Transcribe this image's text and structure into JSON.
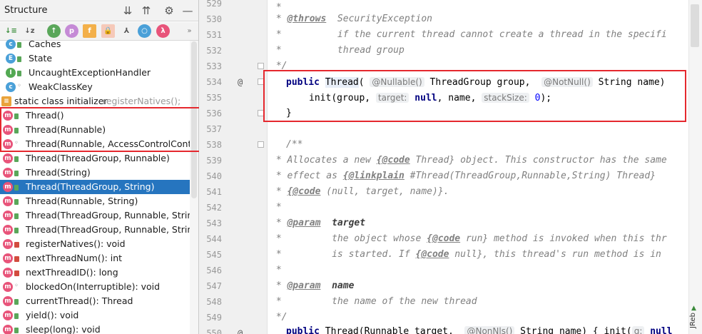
{
  "structure_panel": {
    "title": "Structure",
    "header_buttons": [
      "expand-all-icon",
      "collapse-all-icon",
      "gear-icon",
      "minimize-icon"
    ],
    "toolbar": [
      "sort-by-visibility",
      "sort-alpha",
      "show-inherited",
      "show-properties",
      "show-fields",
      "show-non-public",
      "show-anonymous",
      "show-lambdas",
      "more"
    ],
    "rows": [
      {
        "kind": "c",
        "vis": "pub",
        "label": "Caches",
        "indent": 4
      },
      {
        "kind": "e",
        "vis": "pub",
        "label": "State",
        "indent": 4
      },
      {
        "kind": "i",
        "vis": "pub",
        "label": "UncaughtExceptionHandler",
        "indent": 4
      },
      {
        "kind": "c",
        "vis": "pkg",
        "label": "WeakClassKey",
        "indent": 4
      },
      {
        "kind": "init",
        "vis": "",
        "label": "static class initializer",
        "suffix": "registerNatives();",
        "indent": 0
      },
      {
        "kind": "m",
        "vis": "pub",
        "label": "Thread()",
        "indent": 0
      },
      {
        "kind": "m",
        "vis": "pub",
        "label": "Thread(Runnable)",
        "indent": 0
      },
      {
        "kind": "m",
        "vis": "pkg",
        "label": "Thread(Runnable, AccessControlContext)",
        "indent": 0
      },
      {
        "kind": "m",
        "vis": "pub",
        "label": "Thread(ThreadGroup, Runnable)",
        "indent": 0
      },
      {
        "kind": "m",
        "vis": "pub",
        "label": "Thread(String)",
        "indent": 0
      },
      {
        "kind": "m",
        "vis": "pub",
        "label": "Thread(ThreadGroup, String)",
        "indent": 0,
        "selected": true
      },
      {
        "kind": "m",
        "vis": "pub",
        "label": "Thread(Runnable, String)",
        "indent": 0
      },
      {
        "kind": "m",
        "vis": "pub",
        "label": "Thread(ThreadGroup, Runnable, String)",
        "indent": 0
      },
      {
        "kind": "m",
        "vis": "pub",
        "label": "Thread(ThreadGroup, Runnable, String, lo",
        "indent": 0
      },
      {
        "kind": "m",
        "vis": "priv",
        "label": "registerNatives(): void",
        "indent": 0
      },
      {
        "kind": "m",
        "vis": "priv",
        "label": "nextThreadNum(): int",
        "indent": 0
      },
      {
        "kind": "m",
        "vis": "priv",
        "label": "nextThreadID(): long",
        "indent": 0
      },
      {
        "kind": "m",
        "vis": "pkg",
        "label": "blockedOn(Interruptible): void",
        "indent": 0
      },
      {
        "kind": "m",
        "vis": "pub",
        "label": "currentThread(): Thread",
        "indent": 0
      },
      {
        "kind": "m",
        "vis": "pub",
        "label": "yield(): void",
        "indent": 0
      },
      {
        "kind": "m",
        "vis": "pub",
        "label": "sleep(long): void",
        "indent": 0
      }
    ]
  },
  "editor": {
    "line_numbers": [
      "529",
      "530",
      "531",
      "532",
      "533",
      "534",
      "535",
      "536",
      "537",
      "538",
      "539",
      "540",
      "541",
      "542",
      "543",
      "544",
      "545",
      "546",
      "547",
      "548",
      "549",
      "550"
    ],
    "line_529": " *",
    "line_530": {
      "prefix": " * ",
      "tag": "@throws",
      "rest": "  SecurityException"
    },
    "line_531": " *          if the current thread cannot create a thread in the specifi",
    "line_532": " *          thread group",
    "line_533": " */",
    "line_534": {
      "kw": "public",
      "name": "Thread",
      "open": "(",
      "ann1": "@Nullable()",
      "type1": " ThreadGroup group,  ",
      "ann2": "@NotNull()",
      "type2": " String name)"
    },
    "line_535": {
      "call": "init",
      "p1": "(group, ",
      "hint1": "target:",
      "kw_null": "null",
      "p2": ", name, ",
      "hint2": "stackSize:",
      "zero": "0",
      "end": ");"
    },
    "line_536": "}",
    "line_538": "/**",
    "line_539": {
      "pre": " * Allocates a new ",
      "code_tag": "{@code",
      "post": " Thread} object. This constructor has the same"
    },
    "line_540": {
      "pre": " * effect as ",
      "link_tag": "{@linkplain",
      "post": " #Thread(ThreadGroup,Runnable,String) Thread}"
    },
    "line_541": {
      "pre": " * ",
      "code_tag": "{@code",
      "post": " (null, target, name)}."
    },
    "line_542": " *",
    "line_543": {
      "prefix": " * ",
      "tag": "@param",
      "pname": "  target"
    },
    "line_544": {
      "pre": " *         the object whose ",
      "code_tag": "{@code",
      "post": " run} method is invoked when this thr"
    },
    "line_545": {
      "pre": " *         is started. If ",
      "code_tag": "{@code",
      "post": " null}, this thread's run method is in"
    },
    "line_546": " *",
    "line_547": {
      "prefix": " * ",
      "tag": "@param",
      "pname": "  name"
    },
    "line_548": " *         the name of the new thread",
    "line_549": " */",
    "line_550": {
      "kw": "public",
      "rest": " Thread(Runnable target,  ",
      "ann": "@NonNls()",
      "rest2": " String name) { init(",
      "hint": "g:",
      "null": " null"
    },
    "gutter_marker": "@",
    "jrebel_label": "JReb"
  }
}
